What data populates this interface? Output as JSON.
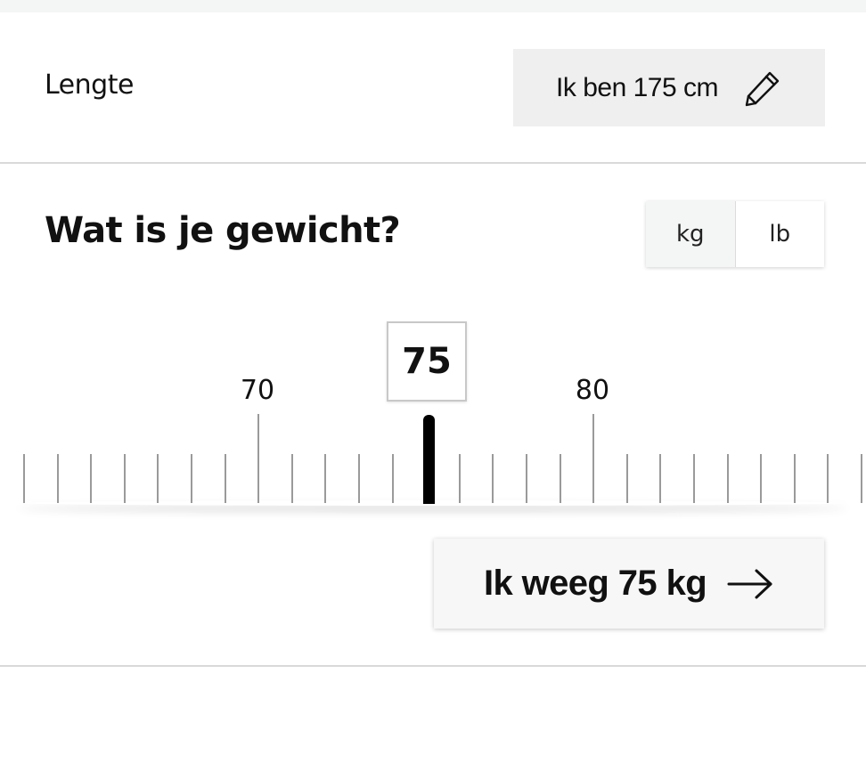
{
  "height_section": {
    "label": "Lengte",
    "button_text": "Ik ben 175 cm",
    "edit_icon": "pencil-icon"
  },
  "weight_section": {
    "question": "Wat is je gewicht?",
    "units": [
      "kg",
      "lb"
    ],
    "selected_unit": "kg",
    "selected_value": "75",
    "ruler_labels": [
      "70",
      "80"
    ],
    "submit_text": "Ik weeg 75 kg",
    "submit_icon": "arrow-right-icon"
  }
}
